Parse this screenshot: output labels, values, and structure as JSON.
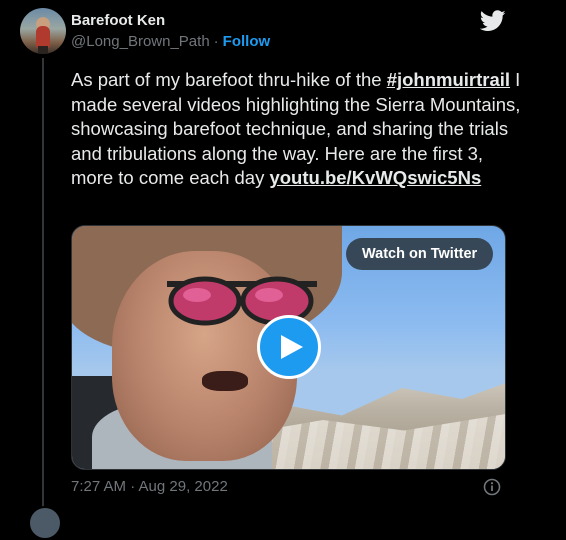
{
  "tweet": {
    "author": {
      "name": "Barefoot Ken",
      "handle": "@Long_Brown_Path",
      "separator": "·",
      "follow_label": "Follow"
    },
    "text_parts": {
      "intro": "As part of my barefoot thru-hike of the ",
      "hashtag": "#johnmuirtrail",
      "body": " I made several videos highlighting the Sierra Mountains, showcasing barefoot technique, and sharing the trials and tribulations along the way.  Here are the first 3, more to come each day ",
      "link": "youtu.be/KvWQswic5Ns"
    },
    "media": {
      "watch_label": "Watch on Twitter"
    },
    "timestamp": "7:27 AM · Aug 29, 2022"
  },
  "colors": {
    "background": "#000000",
    "text": "#e7e9ea",
    "muted": "#71767b",
    "accent": "#1d9bf0"
  },
  "icons": [
    "twitter-bird-icon",
    "play-icon",
    "info-icon"
  ]
}
